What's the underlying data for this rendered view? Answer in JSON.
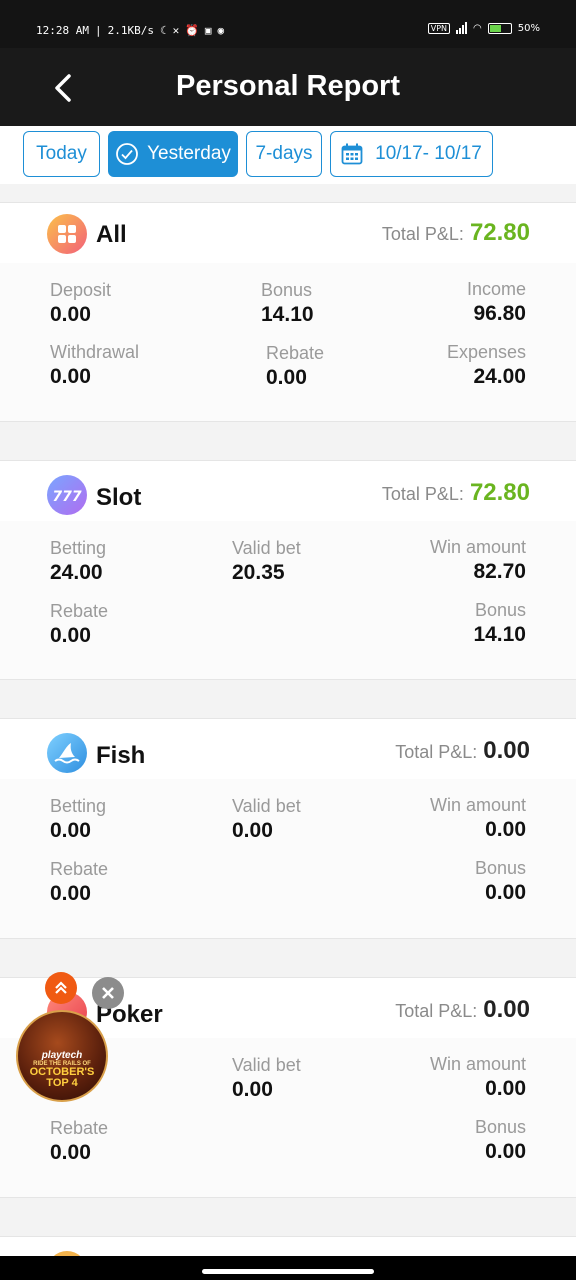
{
  "status_bar": {
    "time": "12:28 AM",
    "speed": "2.1KB/s",
    "vpn": "VPN",
    "battery": "50%"
  },
  "header": {
    "title": "Personal Report"
  },
  "filters": [
    {
      "label": "Today",
      "active": false
    },
    {
      "label": "Yesterday",
      "active": true
    },
    {
      "label": "7-days",
      "active": false
    },
    {
      "label": "10/17- 10/17",
      "active": false
    }
  ],
  "colors": {
    "accent": "#1e8fd6",
    "positive": "#6ab520",
    "header_bg": "#1a1a1a"
  },
  "cards": {
    "all": {
      "name": "All",
      "icon": "grid-icon",
      "pl_label": "Total P&L:",
      "pl_value": "72.80",
      "stats": [
        {
          "label": "Deposit",
          "value": "0.00"
        },
        {
          "label": "Bonus",
          "value": "14.10"
        },
        {
          "label": "Income",
          "value": "96.80"
        },
        {
          "label": "Withdrawal",
          "value": "0.00"
        },
        {
          "label": "Rebate",
          "value": "0.00"
        },
        {
          "label": "Expenses",
          "value": "24.00"
        }
      ]
    },
    "slot": {
      "name": "Slot",
      "icon": "slot-777-icon",
      "pl_label": "Total P&L:",
      "pl_value": "72.80",
      "stats": [
        {
          "label": "Betting",
          "value": "24.00"
        },
        {
          "label": "Valid bet",
          "value": "20.35"
        },
        {
          "label": "Win amount",
          "value": "82.70"
        },
        {
          "label": "Rebate",
          "value": "0.00"
        },
        {
          "label": "Bonus",
          "value": "14.10"
        }
      ]
    },
    "fish": {
      "name": "Fish",
      "icon": "shark-icon",
      "pl_label": "Total P&L:",
      "pl_value": "0.00",
      "stats": [
        {
          "label": "Betting",
          "value": "0.00"
        },
        {
          "label": "Valid bet",
          "value": "0.00"
        },
        {
          "label": "Win amount",
          "value": "0.00"
        },
        {
          "label": "Rebate",
          "value": "0.00"
        },
        {
          "label": "Bonus",
          "value": "0.00"
        }
      ]
    },
    "poker": {
      "name": "Poker",
      "icon": "poker-icon",
      "pl_label": "Total P&L:",
      "pl_value": "0.00",
      "stats": [
        {
          "label": "Valid bet",
          "value": "0.00"
        },
        {
          "label": "Win amount",
          "value": "0.00"
        },
        {
          "label": "Rebate",
          "value": "0.00"
        },
        {
          "label": "Bonus",
          "value": "0.00"
        }
      ]
    }
  },
  "promo": {
    "brand": "playtech",
    "line1": "RIDE THE RAILS OF",
    "line2": "OCTOBER'S",
    "line3": "TOP 4"
  }
}
